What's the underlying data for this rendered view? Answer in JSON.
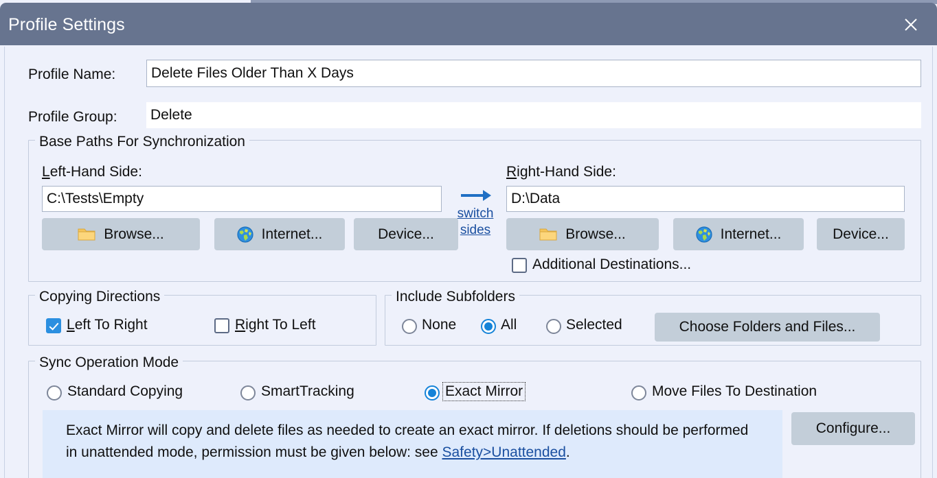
{
  "window": {
    "title": "Profile Settings",
    "close_icon": "close-icon"
  },
  "fields": {
    "profile_name_label": "Profile Name:",
    "profile_name_value": "Delete Files Older Than X Days",
    "profile_group_label": "Profile Group:",
    "profile_group_value": "Delete"
  },
  "base_paths": {
    "legend": "Base Paths For Synchronization",
    "left_label_accel": "L",
    "left_label_rest": "eft-Hand Side:",
    "left_value": "C:\\Tests\\Empty",
    "right_label_accel": "R",
    "right_label_rest": "ight-Hand Side:",
    "right_value": "D:\\Data",
    "browse_label": "Browse...",
    "internet_label": "Internet...",
    "device_label": "Device...",
    "switch_line1": "switch",
    "switch_line2": "sides",
    "switch_arrow_icon": "arrow-right-icon",
    "folder_icon": "folder-icon",
    "globe_icon": "globe-icon",
    "additional_destinations_label": "Additional Destinations...",
    "additional_destinations_checked": false
  },
  "copying_directions": {
    "legend": "Copying Directions",
    "left_to_right_accel": "L",
    "left_to_right_rest": "eft To Right",
    "left_to_right_checked": true,
    "right_to_left_accel": "R",
    "right_to_left_rest": "ight To Left",
    "right_to_left_checked": false
  },
  "include_subfolders": {
    "legend": "Include Subfolders",
    "options": [
      {
        "label": "None",
        "selected": false
      },
      {
        "label": "All",
        "selected": true
      },
      {
        "label": "Selected",
        "selected": false
      }
    ],
    "choose_button_label": "Choose Folders and Files..."
  },
  "sync_operation_mode": {
    "legend": "Sync Operation Mode",
    "options": [
      {
        "label": "Standard Copying",
        "selected": false,
        "focused": false
      },
      {
        "label": "SmartTracking",
        "selected": false,
        "focused": false
      },
      {
        "label": "Exact Mirror",
        "selected": true,
        "focused": true
      },
      {
        "label": "Move Files To Destination",
        "selected": false,
        "focused": false
      }
    ],
    "configure_label": "Configure...",
    "info_text_part1": "Exact Mirror will copy and delete files as needed to create an exact mirror. If deletions should be performed in unattended mode, permission must be given below: see ",
    "info_link": "Safety>Unattended",
    "info_text_part2": "."
  },
  "colors": {
    "titlebar": "#67748f",
    "dialog_background": "#eef1fb",
    "button_face": "#c3ced9",
    "accent_blue": "#1583d8",
    "link_blue": "#1a4fa0",
    "info_panel": "#deeafc"
  }
}
